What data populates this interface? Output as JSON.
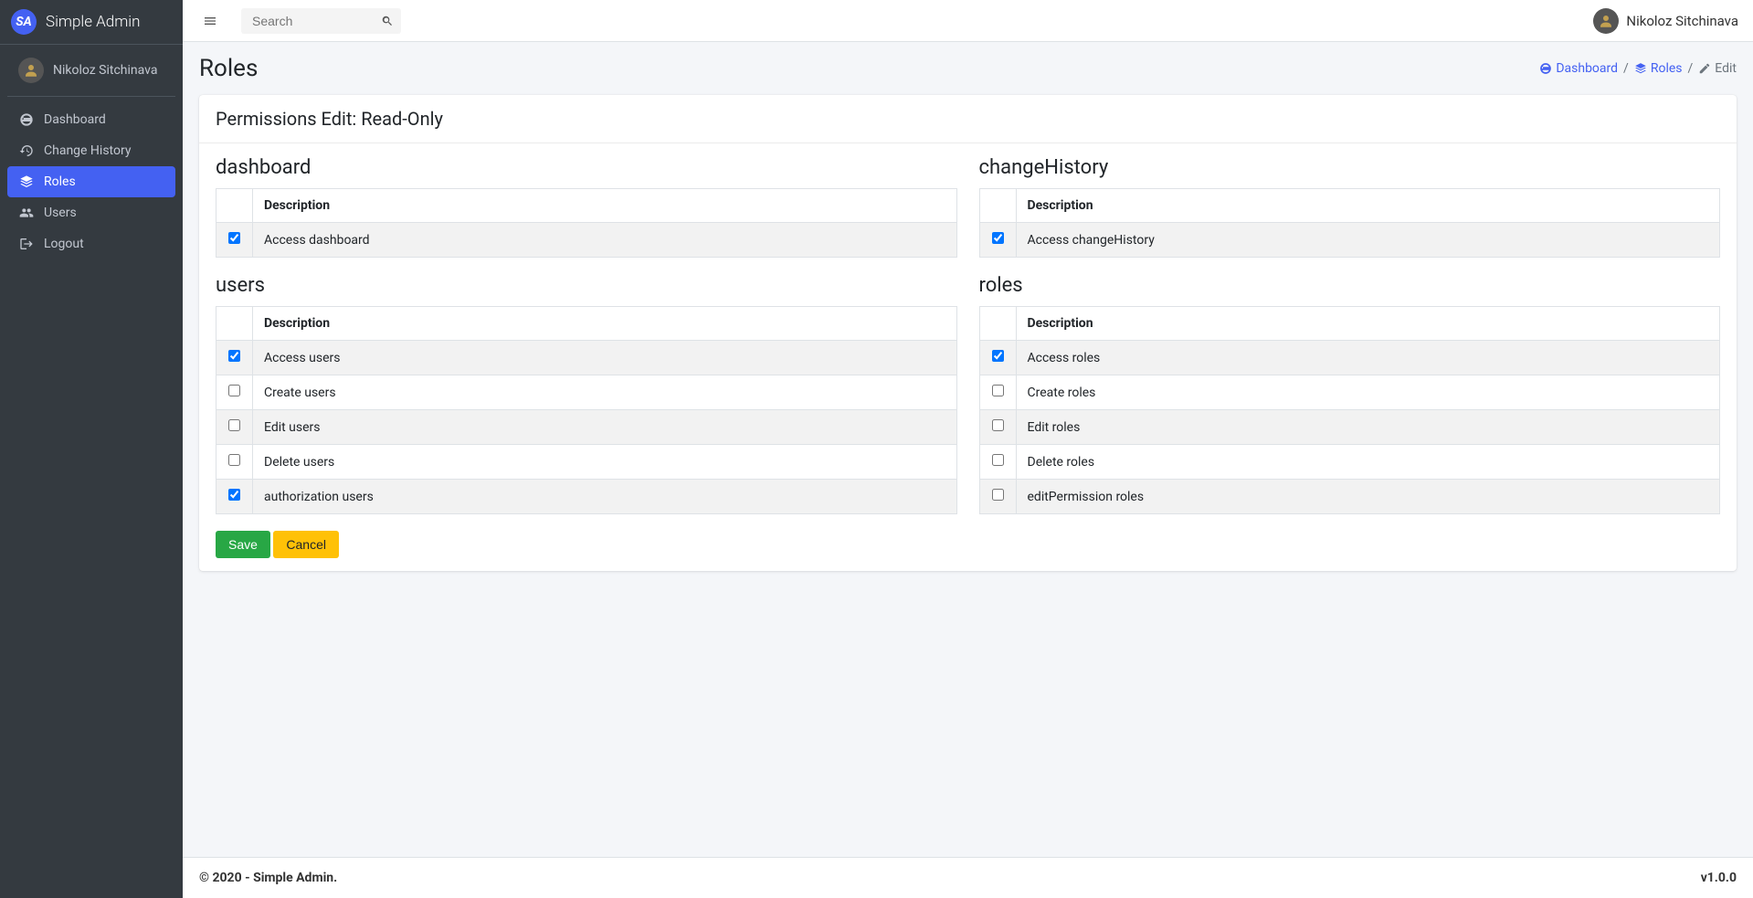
{
  "brand": {
    "logo_text": "SA",
    "name": "Simple Admin"
  },
  "user": {
    "name": "Nikoloz Sitchinava"
  },
  "sidebar": {
    "items": [
      {
        "label": "Dashboard",
        "icon": "dashboard-icon",
        "active": false
      },
      {
        "label": "Change History",
        "icon": "history-icon",
        "active": false
      },
      {
        "label": "Roles",
        "icon": "layers-icon",
        "active": true
      },
      {
        "label": "Users",
        "icon": "users-icon",
        "active": false
      },
      {
        "label": "Logout",
        "icon": "logout-icon",
        "active": false
      }
    ]
  },
  "search": {
    "placeholder": "Search"
  },
  "page": {
    "title": "Roles"
  },
  "breadcrumb": {
    "dashboard": "Dashboard",
    "roles": "Roles",
    "edit": "Edit"
  },
  "card": {
    "title": "Permissions Edit: Read-Only"
  },
  "table_header": "Description",
  "sections": {
    "dashboard": {
      "title": "dashboard",
      "rows": [
        {
          "checked": true,
          "desc": "Access dashboard"
        }
      ]
    },
    "changeHistory": {
      "title": "changeHistory",
      "rows": [
        {
          "checked": true,
          "desc": "Access changeHistory"
        }
      ]
    },
    "users": {
      "title": "users",
      "rows": [
        {
          "checked": true,
          "desc": "Access users"
        },
        {
          "checked": false,
          "desc": "Create users"
        },
        {
          "checked": false,
          "desc": "Edit users"
        },
        {
          "checked": false,
          "desc": "Delete users"
        },
        {
          "checked": true,
          "desc": "authorization users"
        }
      ]
    },
    "roles": {
      "title": "roles",
      "rows": [
        {
          "checked": true,
          "desc": "Access roles"
        },
        {
          "checked": false,
          "desc": "Create roles"
        },
        {
          "checked": false,
          "desc": "Edit roles"
        },
        {
          "checked": false,
          "desc": "Delete roles"
        },
        {
          "checked": false,
          "desc": "editPermission roles"
        }
      ]
    }
  },
  "buttons": {
    "save": "Save",
    "cancel": "Cancel"
  },
  "footer": {
    "copyright": "© 2020 - Simple Admin.",
    "version": "v1.0.0"
  }
}
